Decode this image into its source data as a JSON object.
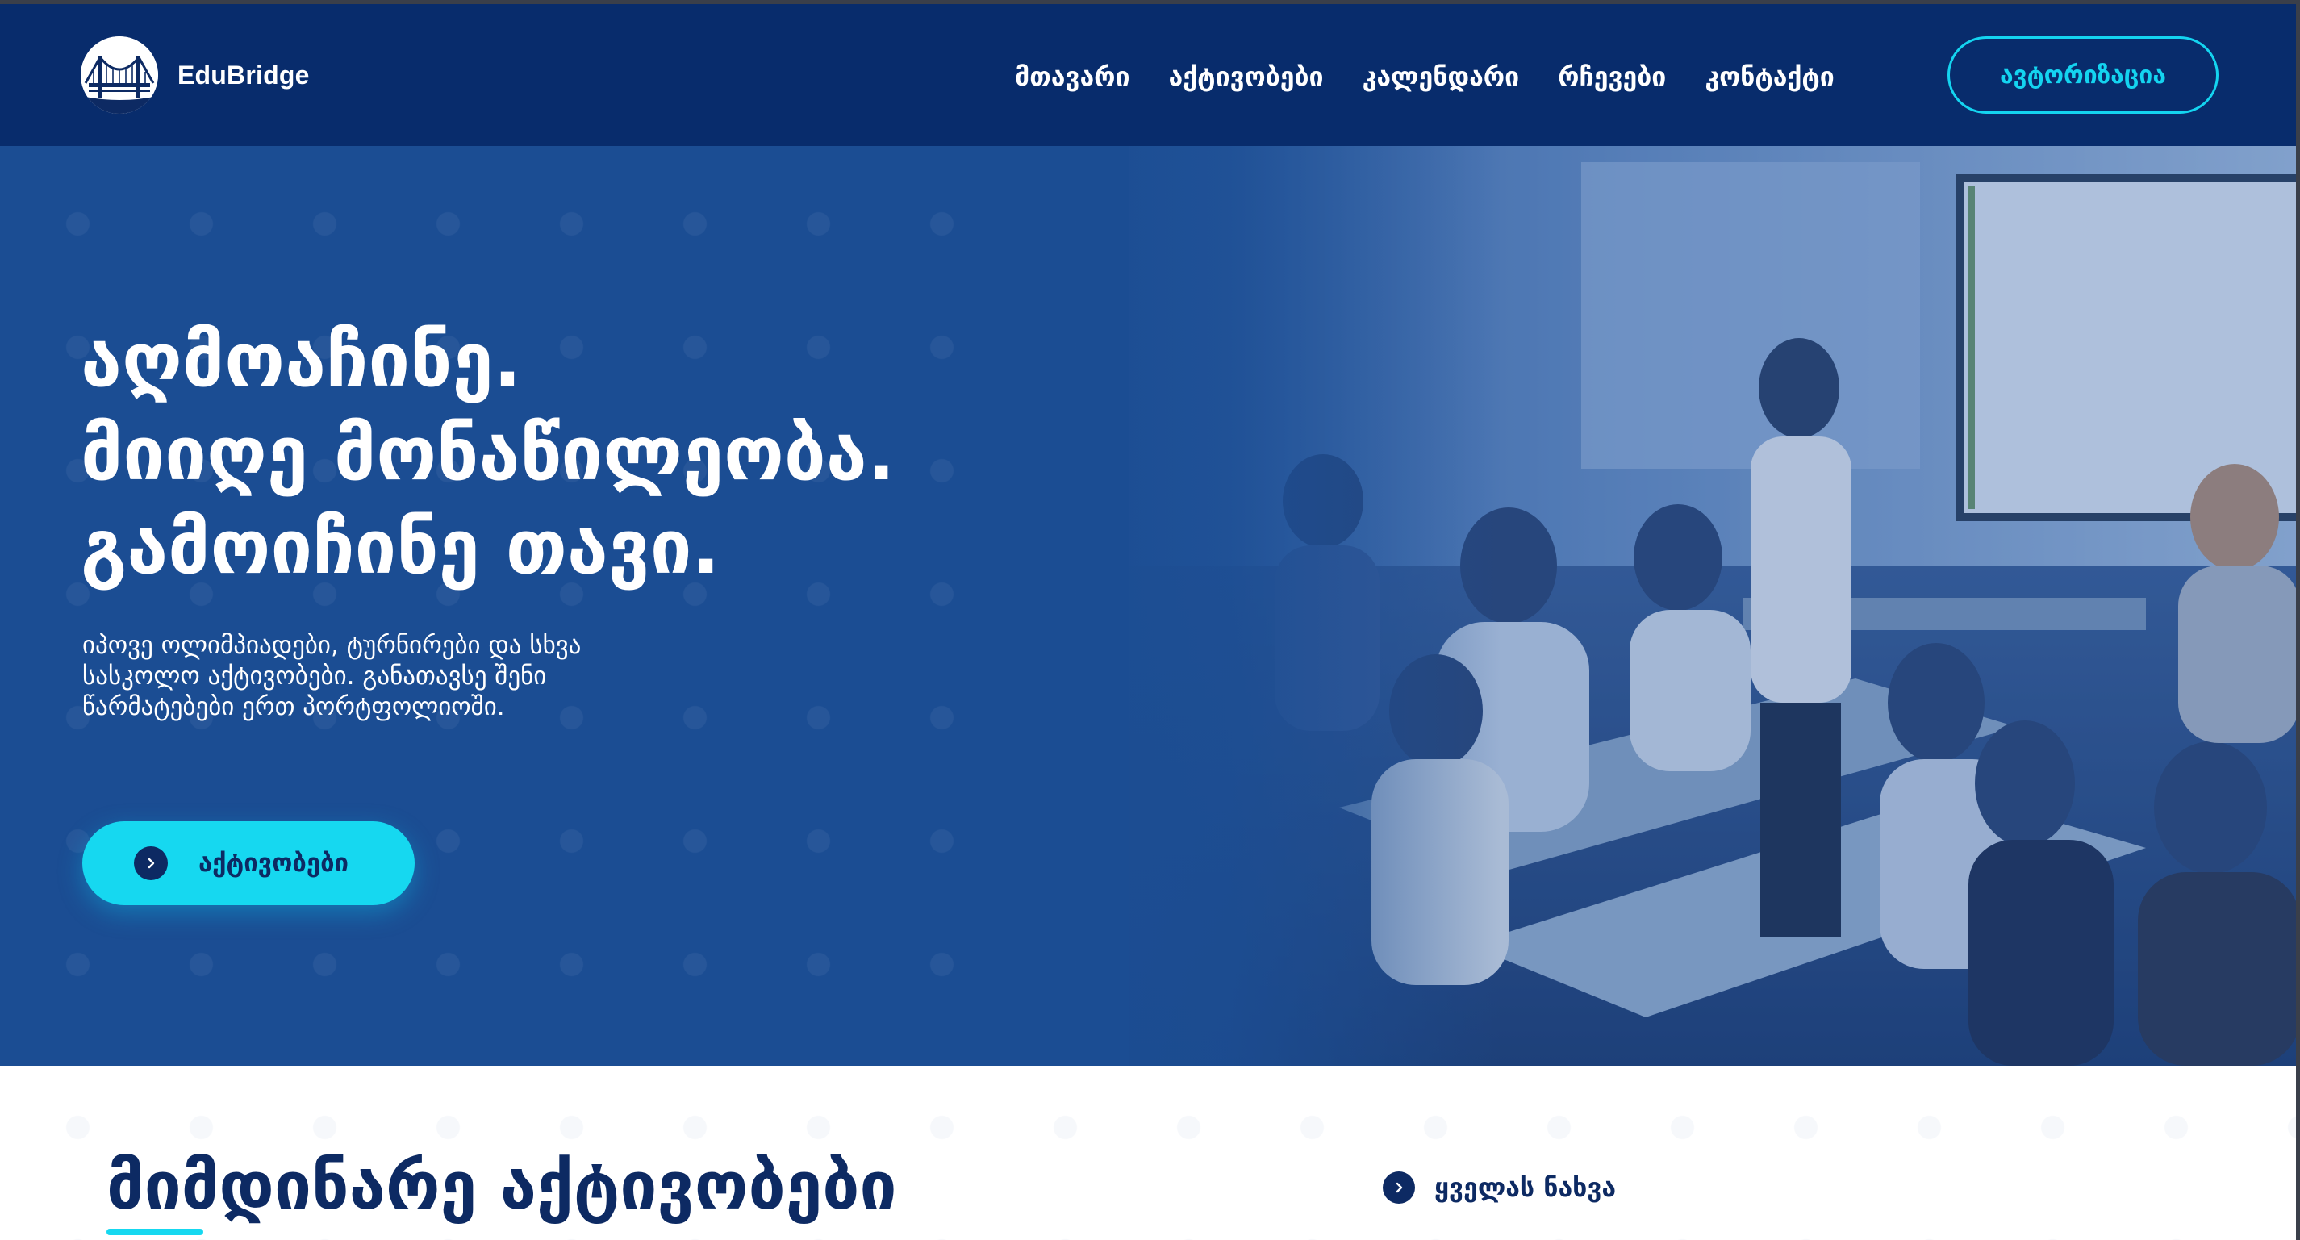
{
  "header": {
    "brand_name": "EduBridge",
    "nav": [
      {
        "label": "მთავარი"
      },
      {
        "label": "აქტივობები"
      },
      {
        "label": "კალენდარი"
      },
      {
        "label": "რჩევები"
      },
      {
        "label": "კონტაქტი"
      }
    ],
    "auth_label": "ავტორიზაცია"
  },
  "hero": {
    "title_lines": [
      "აღმოაჩინე.",
      "მიიღე მონაწილეობა.",
      "გამოიჩინე თავი."
    ],
    "description": "იპოვე ოლიმპიადები, ტურნირები და სხვა სასკოლო აქტივობები. განათავსე შენი წარმატებები ერთ პორტფოლიოში.",
    "cta_label": "აქტივობები",
    "image": "classroom-photo"
  },
  "section": {
    "title": "მიმდინარე აქტივობები",
    "see_all_label": "ყველას ნახვა"
  },
  "colors": {
    "header_bg": "#082c6c",
    "hero_bg": "#1b4d93",
    "accent": "#16d8f0",
    "dark_text": "#0d2a63"
  }
}
